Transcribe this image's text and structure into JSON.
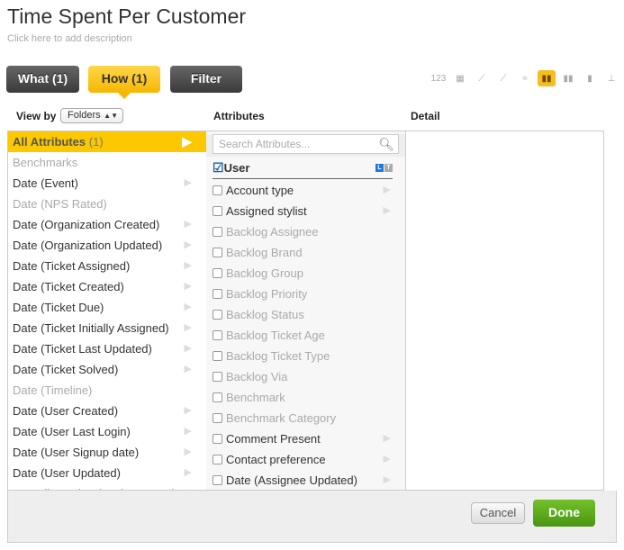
{
  "title": "Time Spent Per Customer",
  "description_placeholder": "Click here to add description",
  "tabs": [
    {
      "label": "What (1)"
    },
    {
      "label": "How (1)"
    },
    {
      "label": "Filter"
    }
  ],
  "chart_types": [
    "number",
    "table",
    "line",
    "line-grid",
    "area",
    "bar",
    "stacked-bar",
    "bar-gray",
    "column-scatter"
  ],
  "selected_chart_type": "bar",
  "view_by": {
    "label": "View by",
    "value": "Folders"
  },
  "columns": {
    "attributes": "Attributes",
    "detail": "Detail"
  },
  "folders": [
    {
      "label": "All Attributes",
      "count": "(1)",
      "selected": true,
      "disabled": false,
      "arrow": true
    },
    {
      "label": "Benchmarks",
      "disabled": true,
      "arrow": false
    },
    {
      "label": "Date (Event)",
      "disabled": false,
      "arrow": true
    },
    {
      "label": "Date (NPS Rated)",
      "disabled": true,
      "arrow": false
    },
    {
      "label": "Date (Organization Created)",
      "disabled": false,
      "arrow": true
    },
    {
      "label": "Date (Organization Updated)",
      "disabled": false,
      "arrow": true
    },
    {
      "label": "Date (Ticket Assigned)",
      "disabled": false,
      "arrow": true
    },
    {
      "label": "Date (Ticket Created)",
      "disabled": false,
      "arrow": true
    },
    {
      "label": "Date (Ticket Due)",
      "disabled": false,
      "arrow": true
    },
    {
      "label": "Date (Ticket Initially Assigned)",
      "disabled": false,
      "arrow": true
    },
    {
      "label": "Date (Ticket Last Updated)",
      "disabled": false,
      "arrow": true
    },
    {
      "label": "Date (Ticket Solved)",
      "disabled": false,
      "arrow": true
    },
    {
      "label": "Date (Timeline)",
      "disabled": true,
      "arrow": false
    },
    {
      "label": "Date (User Created)",
      "disabled": false,
      "arrow": true
    },
    {
      "label": "Date (User Last Login)",
      "disabled": false,
      "arrow": true
    },
    {
      "label": "Date (User Signup date)",
      "disabled": false,
      "arrow": true
    },
    {
      "label": "Date (User Updated)",
      "disabled": false,
      "arrow": true
    },
    {
      "label": "Date dimension (Assignee Upd...",
      "disabled": false,
      "arrow": true
    }
  ],
  "search_placeholder": "Search Attributes...",
  "selected_attribute": {
    "label": "User",
    "checked": true,
    "badges": [
      "L",
      "T"
    ]
  },
  "attributes": [
    {
      "label": "Account type",
      "disabled": false,
      "arrow": true
    },
    {
      "label": "Assigned stylist",
      "disabled": false,
      "arrow": true
    },
    {
      "label": "Backlog Assignee",
      "disabled": true
    },
    {
      "label": "Backlog Brand",
      "disabled": true
    },
    {
      "label": "Backlog Group",
      "disabled": true
    },
    {
      "label": "Backlog Priority",
      "disabled": true
    },
    {
      "label": "Backlog Status",
      "disabled": true
    },
    {
      "label": "Backlog Ticket Age",
      "disabled": true
    },
    {
      "label": "Backlog Ticket Type",
      "disabled": true
    },
    {
      "label": "Backlog Via",
      "disabled": true
    },
    {
      "label": "Benchmark",
      "disabled": true
    },
    {
      "label": "Benchmark Category",
      "disabled": true
    },
    {
      "label": "Comment Present",
      "disabled": false,
      "arrow": true
    },
    {
      "label": "Contact preference",
      "disabled": false,
      "arrow": true
    },
    {
      "label": "Date (Assignee Updated)",
      "disabled": false,
      "arrow": true
    }
  ],
  "buttons": {
    "cancel": "Cancel",
    "done": "Done"
  },
  "colors": {
    "accent": "#fcc800",
    "done": "#5aa51c"
  }
}
